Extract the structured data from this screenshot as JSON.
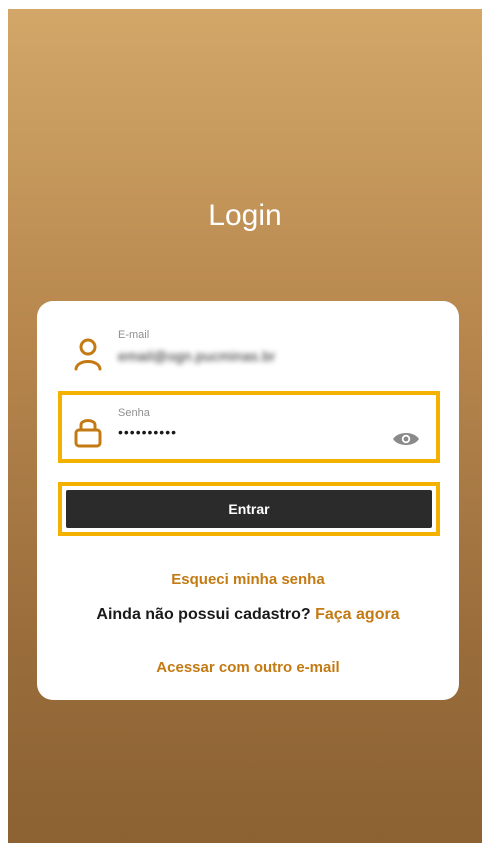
{
  "page": {
    "title": "Login"
  },
  "form": {
    "email": {
      "label": "E-mail",
      "value": "email@ogn.pucminas.br",
      "icon": "person-icon"
    },
    "password": {
      "label": "Senha",
      "value": "••••••••••",
      "icon": "lock-icon",
      "toggle_icon": "eye-icon"
    },
    "submit_label": "Entrar"
  },
  "links": {
    "forgot": "Esqueci minha senha",
    "register_prompt": "Ainda não possui cadastro?",
    "register_cta": "Faça agora",
    "other_email": "Acessar com outro e-mail"
  },
  "colors": {
    "accent": "#c47a13",
    "highlight": "#f4b100",
    "button": "#2b2b2b",
    "gradient_top": "#d2a768",
    "gradient_bottom": "#8c6233"
  }
}
